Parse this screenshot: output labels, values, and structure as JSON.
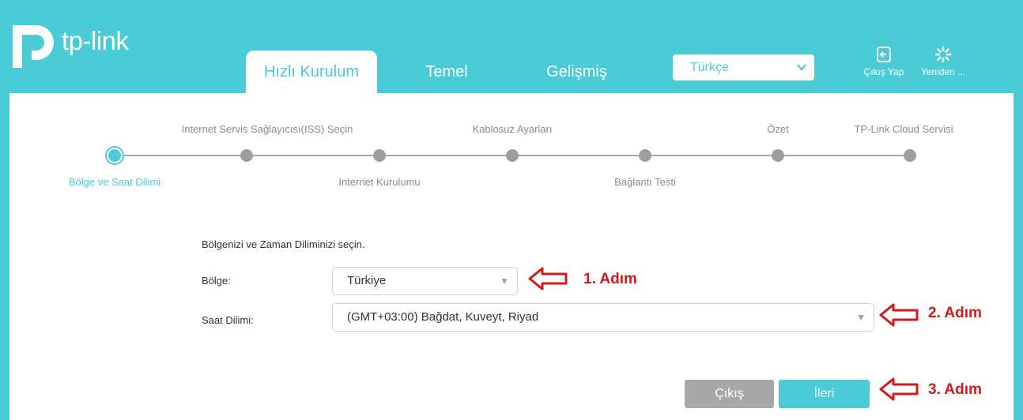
{
  "header": {
    "logo_text": "tp-link",
    "tabs": [
      {
        "label": "Hızlı Kurulum",
        "active": true
      },
      {
        "label": "Temel",
        "active": false
      },
      {
        "label": "Gelişmiş",
        "active": false
      }
    ],
    "language": {
      "value": "Türkçe"
    },
    "logout_label": "Çıkış Yap",
    "reboot_label": "Yeniden ..."
  },
  "stepper": {
    "steps": [
      {
        "label": "Bölge ve Saat Dilimi",
        "current": true
      },
      {
        "label": "Internet Servis Sağlayıcısı(ISS) Seçin",
        "current": false
      },
      {
        "label": "Internet Kurulumu",
        "current": false
      },
      {
        "label": "Kablosuz Ayarları",
        "current": false
      },
      {
        "label": "Bağlantı Testi",
        "current": false
      },
      {
        "label": "Özet",
        "current": false
      },
      {
        "label": "TP-Link Cloud Servisi",
        "current": false
      }
    ]
  },
  "form": {
    "title": "Bölgenizi ve Zaman Diliminizi seçin.",
    "region_label": "Bölge:",
    "region_value": "Türkiye",
    "timezone_label": "Saat Dilimi:",
    "timezone_value": "(GMT+03:00) Bağdat, Kuveyt, Riyad"
  },
  "buttons": {
    "exit": "Çıkış",
    "next": "İleri"
  },
  "annotations": {
    "step1": "1. Adım",
    "step2": "2. Adım",
    "step3": "3. Adım"
  },
  "colors": {
    "brand": "#4acbd6",
    "annotation": "#d11a1a",
    "inactive": "#a8a8a8"
  }
}
